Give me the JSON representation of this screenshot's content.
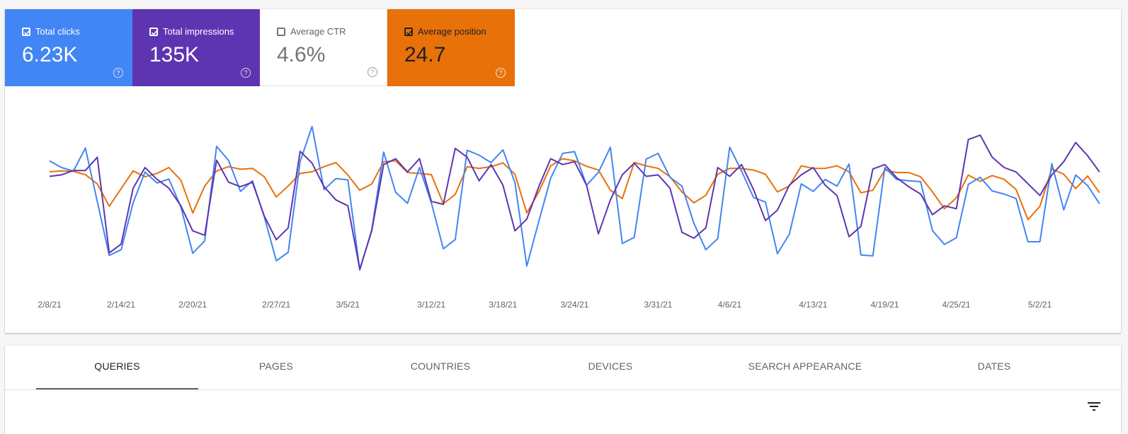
{
  "metrics": [
    {
      "label": "Total clicks",
      "value": "6.23K",
      "checked": true,
      "color": "#4285f4"
    },
    {
      "label": "Total impressions",
      "value": "135K",
      "checked": true,
      "color": "#5e35b1"
    },
    {
      "label": "Average CTR",
      "value": "4.6%",
      "checked": false,
      "color": "#00897b"
    },
    {
      "label": "Average position",
      "value": "24.7",
      "checked": true,
      "color": "#e8710a"
    }
  ],
  "help_glyph": "?",
  "tabs": [
    {
      "label": "QUERIES",
      "active": true
    },
    {
      "label": "PAGES",
      "active": false
    },
    {
      "label": "COUNTRIES",
      "active": false
    },
    {
      "label": "DEVICES",
      "active": false
    },
    {
      "label": "SEARCH APPEARANCE",
      "active": false
    },
    {
      "label": "DATES",
      "active": false
    }
  ],
  "filter_icon": "filter-list-icon",
  "chart_data": {
    "type": "line",
    "x_labels": [
      "2/8/21",
      "2/14/21",
      "2/20/21",
      "2/27/21",
      "3/5/21",
      "3/12/21",
      "3/18/21",
      "3/24/21",
      "3/31/21",
      "4/6/21",
      "4/13/21",
      "4/19/21",
      "4/25/21",
      "5/2/21"
    ],
    "x_label_day_index": [
      0,
      6,
      12,
      19,
      25,
      32,
      38,
      44,
      51,
      57,
      64,
      70,
      76,
      83
    ],
    "y_axis_labels_shown": false,
    "grid": false,
    "series": [
      {
        "name": "Total impressions",
        "color": "#5e35b1",
        "values": [
          78,
          79,
          82,
          82,
          91,
          26,
          32,
          70,
          84,
          76,
          70,
          58,
          41,
          38,
          89,
          74,
          71,
          74,
          51,
          35,
          43,
          95,
          87,
          71,
          62,
          58,
          15,
          41,
          86,
          90,
          81,
          90,
          61,
          59,
          97,
          91,
          75,
          86,
          72,
          41,
          49,
          71,
          90,
          86,
          88,
          72,
          39,
          62,
          79,
          87,
          78,
          79,
          70,
          40,
          36,
          43,
          84,
          78,
          86,
          69,
          48,
          55,
          72,
          79,
          84,
          72,
          65,
          37,
          44,
          83,
          86,
          77,
          71,
          66,
          52,
          58,
          56,
          103,
          106,
          91,
          84,
          81,
          73,
          65,
          79,
          88,
          101,
          92,
          81
        ],
        "ylim": [
          0,
          120
        ]
      },
      {
        "name": "Total clicks",
        "color": "#4285f4",
        "values": [
          345,
          330,
          322,
          374,
          253,
          131,
          144,
          250,
          320,
          295,
          304,
          241,
          136,
          164,
          378,
          346,
          276,
          300,
          218,
          119,
          138,
          344,
          423,
          280,
          305,
          302,
          98,
          189,
          365,
          274,
          249,
          330,
          250,
          146,
          167,
          369,
          358,
          341,
          370,
          296,
          107,
          208,
          306,
          362,
          366,
          290,
          319,
          376,
          158,
          172,
          349,
          362,
          308,
          288,
          204,
          144,
          169,
          376,
          322,
          262,
          252,
          135,
          179,
          293,
          276,
          303,
          288,
          338,
          132,
          130,
          330,
          303,
          300,
          298,
          187,
          156,
          171,
          292,
          308,
          277,
          270,
          260,
          162,
          162,
          339,
          234,
          313,
          289,
          248
        ],
        "ylim": [
          50,
          450
        ]
      },
      {
        "name": "Average position",
        "color": "#e8710a",
        "values": [
          27.6,
          27.4,
          27.5,
          28.3,
          30.5,
          35.8,
          31.6,
          27.4,
          28.8,
          28.0,
          26.6,
          29.6,
          37.4,
          31.0,
          27.4,
          26.4,
          27.0,
          26.8,
          28.8,
          33.6,
          31.0,
          28.0,
          27.6,
          26.4,
          25.4,
          28.4,
          32.0,
          30.5,
          25.2,
          25.0,
          27.8,
          28.0,
          28.3,
          35.2,
          33.0,
          26.4,
          26.8,
          26.4,
          25.5,
          28.2,
          37.4,
          32.4,
          26.2,
          24.5,
          25.0,
          26.3,
          27.2,
          32.0,
          34.0,
          25.4,
          26.2,
          26.8,
          28.8,
          32.4,
          35.0,
          33.2,
          28.2,
          26.8,
          26.8,
          27.2,
          28.2,
          32.4,
          31.0,
          26.2,
          26.8,
          26.8,
          26.2,
          27.6,
          32.6,
          32.0,
          27.2,
          27.8,
          27.8,
          28.8,
          32.4,
          36.4,
          33.8,
          28.4,
          29.9,
          28.5,
          29.4,
          31.8,
          39.0,
          35.8,
          26.9,
          28.2,
          31.6,
          28.6,
          32.6
        ],
        "ylim": [
          14,
          56
        ],
        "inverted": true
      }
    ]
  }
}
